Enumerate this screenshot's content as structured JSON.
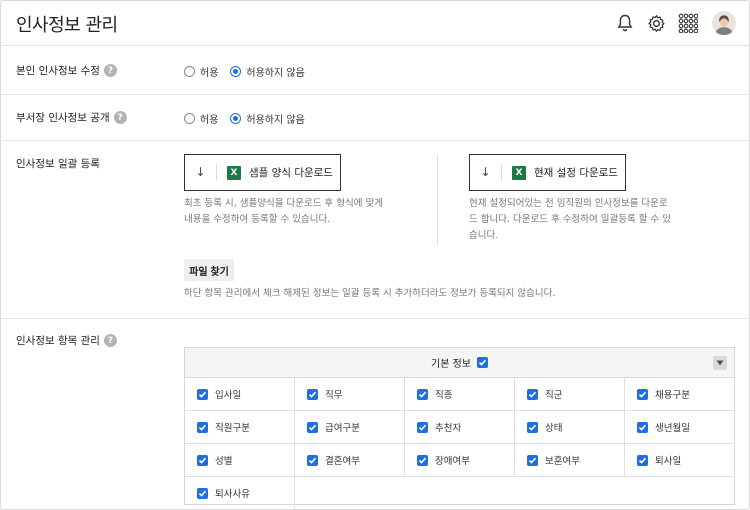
{
  "header": {
    "title": "인사정보 관리",
    "icons": [
      "bell-icon",
      "gear-icon",
      "apps-grid-icon",
      "avatar"
    ]
  },
  "self_edit": {
    "label": "본인 인사정보 수정",
    "options": [
      "허용",
      "허용하지 않음"
    ],
    "selected": "허용하지 않음"
  },
  "dept_head_public": {
    "label": "부서장 인사정보 공개",
    "options": [
      "허용",
      "허용하지 않음"
    ],
    "selected": "허용하지 않음"
  },
  "bulk_register": {
    "label": "인사정보 일괄 등록",
    "sample_button": "샘플 양식 다운로드",
    "sample_desc_1": "최초 등록 시, 샘플양식을 다운로드 후 형식에 맞게",
    "sample_desc_2": "내용을 수정하여 등록할 수 있습니다.",
    "current_button": "현재 설정 다운로드",
    "current_desc_1": "현재 설정되어있는 전 임직원의 인사정보를 다운로",
    "current_desc_2": "드 합니다. 다운로드 후 수정하여 일괄등록 할 수 있",
    "current_desc_3": "습니다.",
    "file_button": "파일 찾기",
    "note": "하단 항목 관리에서 체크 해제된 정보는 일괄 등록 시 추가하더라도 정보가 등록되지 않습니다."
  },
  "field_mgmt": {
    "label": "인사정보 항목 관리",
    "group_title": "기본 정보",
    "items": [
      "입사일",
      "직무",
      "직종",
      "직군",
      "채용구분",
      "직원구분",
      "급여구분",
      "추천자",
      "상태",
      "생년월일",
      "성별",
      "결혼여부",
      "장애여부",
      "보훈여부",
      "퇴사일",
      "퇴사사유"
    ]
  },
  "colors": {
    "accent": "#1f6fe0",
    "excel": "#1d7a45"
  }
}
